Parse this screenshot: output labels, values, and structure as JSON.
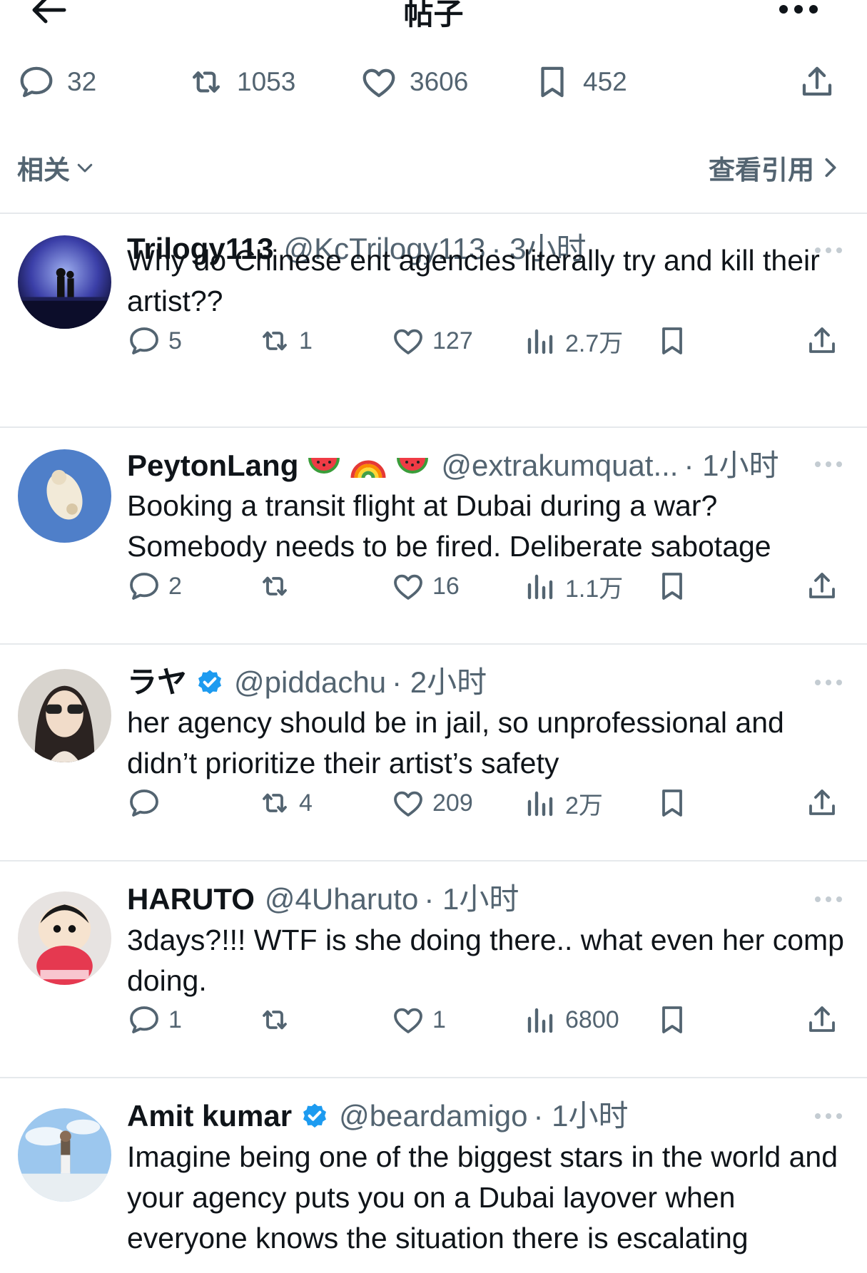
{
  "header": {
    "title": "帖子",
    "back_icon": "arrow-left-icon",
    "more_icon": "more-horizontal-icon"
  },
  "post_stats": {
    "replies": "32",
    "reposts": "1053",
    "likes": "3606",
    "bookmarks": "452"
  },
  "filters": {
    "sort_label": "相关",
    "quotes_label": "查看引用"
  },
  "tweets": [
    {
      "name": "Trilogy113",
      "handle": "@KcTrilogy113",
      "time": "· 3小时",
      "text": "Why do Chinese ent agencies literally try and kill their artist??",
      "replies": "5",
      "reposts": "1",
      "likes": "127",
      "views": "2.7万"
    },
    {
      "name": "PeytonLang",
      "emoji": [
        "watermelon",
        "rainbow",
        "watermelon"
      ],
      "handle": "@extrakumquat...",
      "time": "· 1小时",
      "text": "Booking a transit flight at Dubai during a war? Somebody needs to be fired. Deliberate sabotage",
      "replies": "2",
      "reposts": "",
      "likes": "16",
      "views": "1.1万"
    },
    {
      "name": "ラヤ",
      "verified": true,
      "handle": "@piddachu",
      "time": "· 2小时",
      "text": "her agency should be in jail, so unprofessional and didn’t prioritize their artist’s safety",
      "replies": "",
      "reposts": "4",
      "likes": "209",
      "views": "2万"
    },
    {
      "name": "HARUTO",
      "handle": "@4Uharuto",
      "time": "· 1小时",
      "text": "3days?!!! WTF is she doing there.. what even her comp doing.",
      "replies": "1",
      "reposts": "",
      "likes": "1",
      "views": "6800"
    },
    {
      "name": "Amit kumar",
      "verified": true,
      "handle": "@beardamigo",
      "time": "· 1小时",
      "text": "Imagine being one of the biggest stars in the world and your agency puts you on a Dubai layover when everyone knows the situation there is escalating",
      "replies": "",
      "reposts": "",
      "likes": "",
      "views": ""
    }
  ],
  "colors": {
    "text": "#0f1419",
    "secondary": "#536471",
    "divider": "#e6e9ec",
    "verified": "#1d9bf0"
  }
}
